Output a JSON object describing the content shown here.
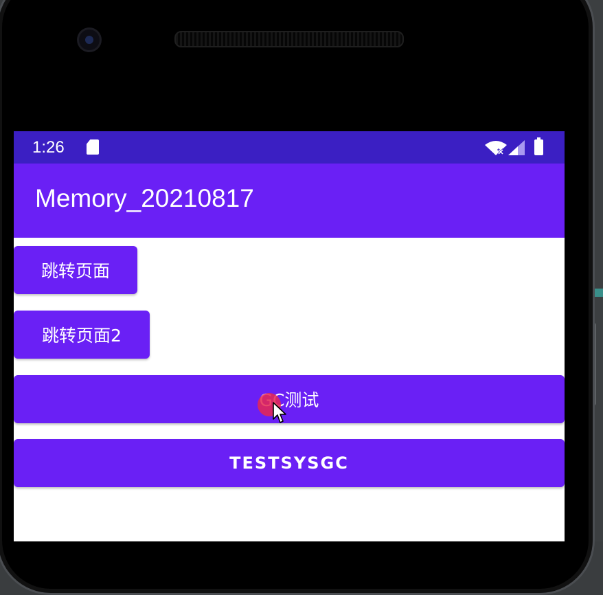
{
  "status_bar": {
    "time": "1:26",
    "icons": [
      "sd-card-icon",
      "wifi-off-icon",
      "signal-icon",
      "battery-icon"
    ]
  },
  "app_bar": {
    "title": "Memory_20210817"
  },
  "buttons": [
    {
      "label": "跳转页面"
    },
    {
      "label": "跳转页面2"
    },
    {
      "label": "GC测试"
    },
    {
      "label": "TESTSYSGC"
    }
  ],
  "colors": {
    "primary": "#6A20F5",
    "status_bar": "#3B1FC3",
    "background": "#FFFFFF",
    "touch_indicator": "#E62850"
  }
}
